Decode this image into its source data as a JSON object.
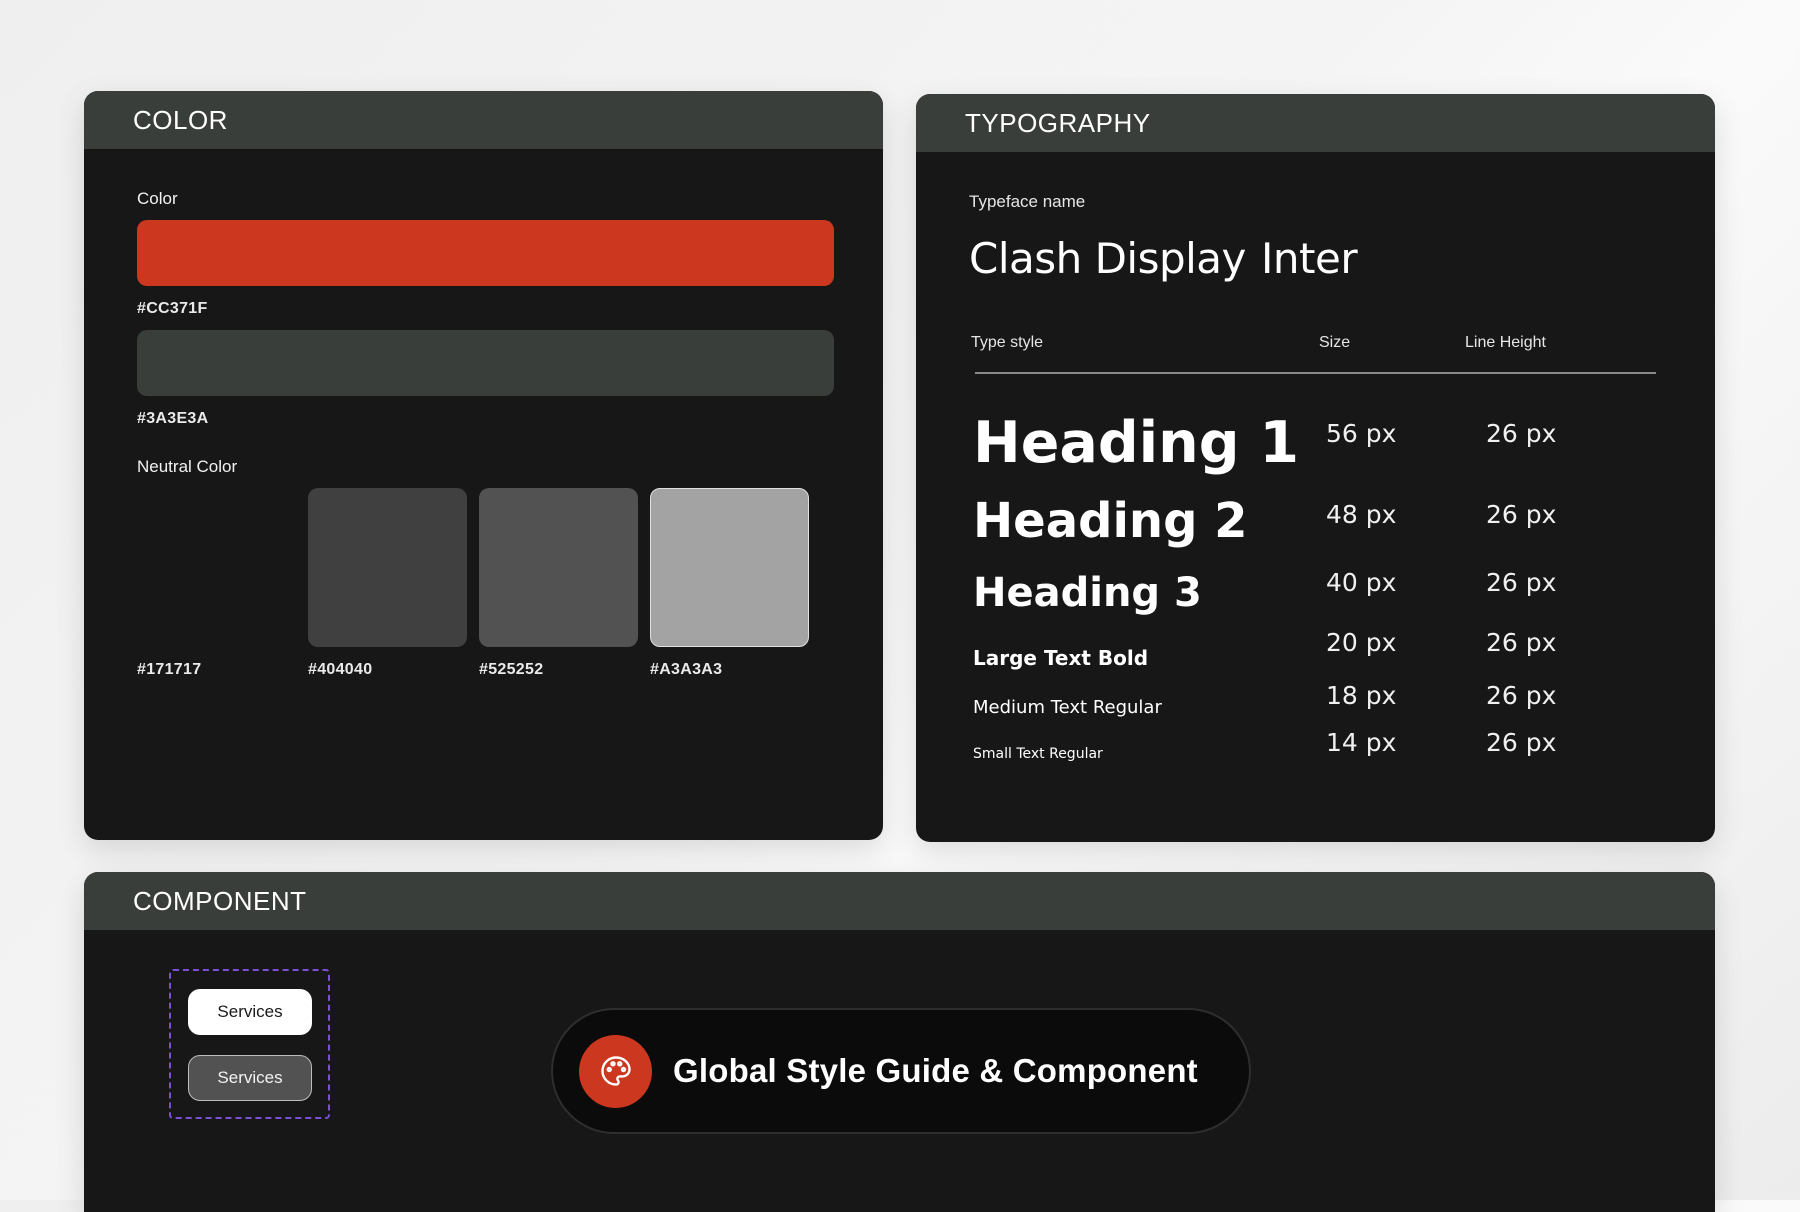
{
  "color_section": {
    "title": "COLOR",
    "color_label": "Color",
    "primary": {
      "hex_label": "#CC371F",
      "value": "#CC371F"
    },
    "secondary": {
      "hex_label": "#3A3E3A",
      "value": "#3A3E3A"
    },
    "neutral_label": "Neutral Color",
    "neutrals": [
      {
        "hex_label": "#171717",
        "value": "#171717"
      },
      {
        "hex_label": "#404040",
        "value": "#404040"
      },
      {
        "hex_label": "#525252",
        "value": "#525252"
      },
      {
        "hex_label": "#A3A3A3",
        "value": "#A3A3A3"
      }
    ]
  },
  "typography_section": {
    "title": "TYPOGRAPHY",
    "typeface_label": "Typeface name",
    "typefaces": [
      "Clash Display",
      "Inter"
    ],
    "columns": {
      "style": "Type style",
      "size": "Size",
      "line_height": "Line Height"
    },
    "styles": [
      {
        "name": "Heading 1",
        "size": "56 px",
        "line_height": "26 px"
      },
      {
        "name": "Heading 2",
        "size": "48 px",
        "line_height": "26 px"
      },
      {
        "name": "Heading 3",
        "size": "40 px",
        "line_height": "26 px"
      },
      {
        "name": "Large Text Bold",
        "size": "20 px",
        "line_height": "26 px"
      },
      {
        "name": "Medium Text Regular",
        "size": "18 px",
        "line_height": "26 px"
      },
      {
        "name": "Small Text Regular",
        "size": "14 px",
        "line_height": "26 px"
      }
    ]
  },
  "component_section": {
    "title": "COMPONENT",
    "buttons": [
      {
        "label": "Services",
        "variant": "light"
      },
      {
        "label": "Services",
        "variant": "dark"
      }
    ],
    "banner": {
      "icon": "palette-icon",
      "text": "Global Style Guide & Component"
    }
  },
  "colors": {
    "accent": "#CC371F",
    "header_bg": "#3A3E3A",
    "card_bg": "#171717",
    "frame_dash": "#7B4FD6"
  }
}
